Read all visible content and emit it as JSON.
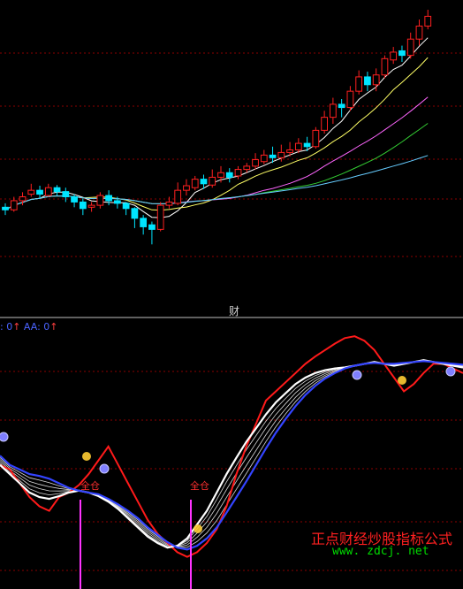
{
  "chart_data": [
    {
      "type": "candlestick",
      "panel": "price",
      "colors": {
        "up": "#ff2020",
        "down": "#00e5ff",
        "grid": "#8b0000"
      },
      "candles": [
        [
          152,
          148,
          140,
          158
        ],
        [
          148,
          162,
          145,
          168
        ],
        [
          162,
          168,
          155,
          175
        ],
        [
          172,
          178,
          168,
          188
        ],
        [
          178,
          172,
          165,
          185
        ],
        [
          170,
          182,
          168,
          188
        ],
        [
          182,
          176,
          170,
          186
        ],
        [
          176,
          168,
          160,
          182
        ],
        [
          168,
          160,
          152,
          172
        ],
        [
          160,
          150,
          140,
          165
        ],
        [
          152,
          155,
          145,
          160
        ],
        [
          155,
          170,
          150,
          175
        ],
        [
          170,
          162,
          155,
          178
        ],
        [
          162,
          158,
          150,
          168
        ],
        [
          158,
          150,
          140,
          160
        ],
        [
          150,
          135,
          120,
          152
        ],
        [
          135,
          122,
          110,
          140
        ],
        [
          125,
          118,
          95,
          130
        ],
        [
          118,
          155,
          115,
          160
        ],
        [
          155,
          160,
          150,
          168
        ],
        [
          158,
          178,
          155,
          190
        ],
        [
          178,
          185,
          170,
          195
        ],
        [
          182,
          195,
          178,
          200
        ],
        [
          195,
          188,
          180,
          202
        ],
        [
          186,
          198,
          182,
          210
        ],
        [
          198,
          205,
          190,
          215
        ],
        [
          205,
          198,
          190,
          212
        ],
        [
          200,
          210,
          195,
          215
        ],
        [
          210,
          215,
          205,
          220
        ],
        [
          215,
          225,
          210,
          235
        ],
        [
          222,
          232,
          218,
          240
        ],
        [
          232,
          228,
          220,
          245
        ],
        [
          228,
          236,
          222,
          248
        ],
        [
          236,
          240,
          230,
          252
        ],
        [
          240,
          250,
          235,
          258
        ],
        [
          250,
          245,
          238,
          260
        ],
        [
          245,
          270,
          242,
          275
        ],
        [
          270,
          290,
          265,
          300
        ],
        [
          290,
          310,
          280,
          320
        ],
        [
          310,
          305,
          290,
          318
        ],
        [
          305,
          330,
          300,
          338
        ],
        [
          330,
          352,
          325,
          362
        ],
        [
          352,
          340,
          330,
          360
        ],
        [
          340,
          355,
          330,
          365
        ],
        [
          355,
          380,
          350,
          385
        ],
        [
          378,
          390,
          372,
          398
        ],
        [
          392,
          385,
          375,
          400
        ],
        [
          385,
          410,
          380,
          420
        ],
        [
          410,
          430,
          400,
          440
        ],
        [
          430,
          445,
          425,
          455
        ]
      ],
      "ma_lines": [
        {
          "name": "",
          "color": "#ffffff"
        },
        {
          "name": "",
          "color": "#ffff66"
        },
        {
          "name": "",
          "color": "#ff66ff"
        },
        {
          "name": "",
          "color": "#33cc33"
        },
        {
          "name": "",
          "color": "#66ccff"
        }
      ]
    },
    {
      "type": "line",
      "panel": "indicator",
      "series": [
        {
          "name": "",
          "color": "#ff1a1a",
          "values": [
            40,
            35,
            20,
            5,
            -5,
            -10,
            5,
            10,
            18,
            30,
            45,
            60,
            40,
            20,
            0,
            -20,
            -35,
            -45,
            -55,
            -60,
            -55,
            -45,
            -30,
            -5,
            30,
            60,
            85,
            110,
            120,
            130,
            140,
            150,
            158,
            165,
            172,
            178,
            180,
            175,
            165,
            150,
            135,
            120,
            128,
            140,
            150,
            150,
            145,
            140
          ]
        },
        {
          "name": "",
          "color": "#ffffff",
          "values": [
            40,
            30,
            20,
            10,
            5,
            3,
            6,
            10,
            12,
            10,
            6,
            0,
            -8,
            -18,
            -28,
            -38,
            -45,
            -50,
            -48,
            -40,
            -25,
            -10,
            10,
            30,
            48,
            65,
            80,
            95,
            108,
            118,
            128,
            135,
            140,
            143,
            145,
            146,
            148,
            150,
            152,
            150,
            148,
            150,
            152,
            154,
            152,
            150,
            148,
            146
          ]
        },
        {
          "name": "",
          "color": "#3344ff",
          "values": [
            50,
            40,
            35,
            30,
            28,
            25,
            20,
            15,
            12,
            10,
            8,
            3,
            -3,
            -10,
            -18,
            -28,
            -36,
            -44,
            -50,
            -52,
            -48,
            -40,
            -28,
            -12,
            5,
            22,
            40,
            58,
            75,
            90,
            104,
            116,
            126,
            134,
            140,
            145,
            148,
            150,
            151,
            150,
            150,
            151,
            152,
            153,
            152,
            151,
            150,
            149
          ]
        }
      ]
    }
  ],
  "labels": {
    "center_mark": "财",
    "indicator_header_1": ": 0",
    "indicator_header_arrow_1": "↑",
    "indicator_header_2": "AA: 0",
    "indicator_header_arrow_2": "↑",
    "signal_text": "全仓"
  },
  "watermark": {
    "title": "正点财经炒股指标公式",
    "url": "www. zdcj. net"
  }
}
